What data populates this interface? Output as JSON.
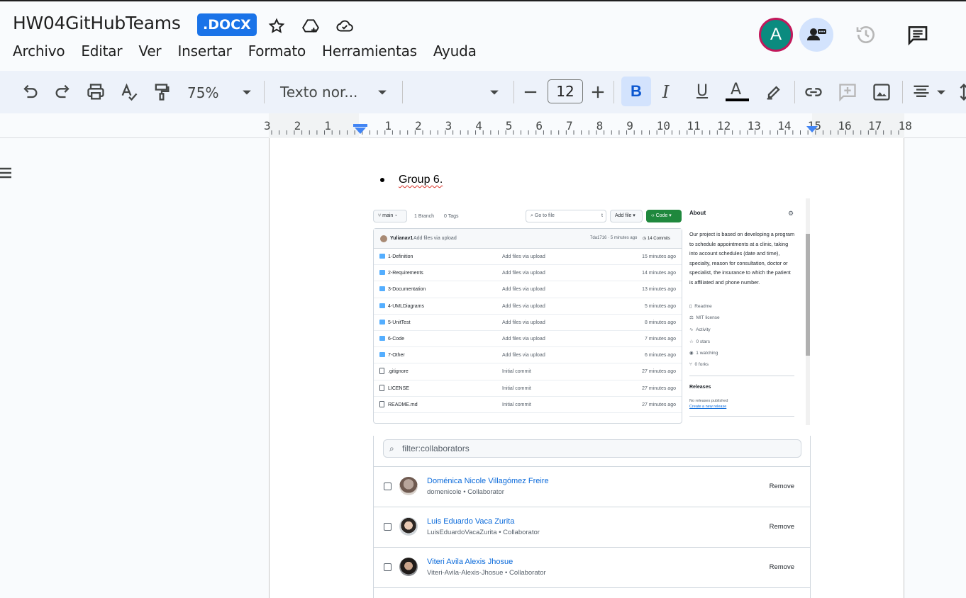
{
  "header": {
    "doc_title": "HW04GitHubTeams",
    "badge": ".DOCX",
    "avatar_letter": "A"
  },
  "menu": [
    "Archivo",
    "Editar",
    "Ver",
    "Insertar",
    "Formato",
    "Herramientas",
    "Ayuda"
  ],
  "toolbar": {
    "zoom": "75%",
    "style": "Texto nor...",
    "font_size": "12",
    "bold": "B",
    "italic": "I",
    "underline": "U",
    "text_color": "A"
  },
  "ruler": [
    "3",
    "2",
    "1",
    "1",
    "2",
    "3",
    "4",
    "5",
    "6",
    "7",
    "8",
    "9",
    "10",
    "11",
    "12",
    "13",
    "14",
    "15",
    "16",
    "17",
    "18"
  ],
  "document": {
    "bullet": "Group 6."
  },
  "repo": {
    "branch": "main",
    "branch_count": "1 Branch",
    "tags": "0 Tags",
    "search_placeholder": "Go to file",
    "search_key": "t",
    "add_file": "Add file",
    "code": "Code",
    "last_author": "Yulianav1",
    "last_message": "Add files via upload",
    "last_hash": "7da1716 · 5 minutes ago",
    "commits": "14 Commits",
    "files": [
      {
        "name": "1-Definition",
        "msg": "Add files via upload",
        "time": "15 minutes ago",
        "kind": "folder"
      },
      {
        "name": "2-Requirements",
        "msg": "Add files via upload",
        "time": "14 minutes ago",
        "kind": "folder"
      },
      {
        "name": "3-Documentation",
        "msg": "Add files via upload",
        "time": "13 minutes ago",
        "kind": "folder"
      },
      {
        "name": "4-UMLDiagrams",
        "msg": "Add files via upload",
        "time": "5 minutes ago",
        "kind": "folder"
      },
      {
        "name": "5-UnitTest",
        "msg": "Add files via upload",
        "time": "8 minutes ago",
        "kind": "folder"
      },
      {
        "name": "6-Code",
        "msg": "Add files via upload",
        "time": "7 minutes ago",
        "kind": "folder"
      },
      {
        "name": "7-Other",
        "msg": "Add files via upload",
        "time": "6 minutes ago",
        "kind": "folder"
      },
      {
        "name": ".gitignore",
        "msg": "Initial commit",
        "time": "27 minutes ago",
        "kind": "file"
      },
      {
        "name": "LICENSE",
        "msg": "Initial commit",
        "time": "27 minutes ago",
        "kind": "file"
      },
      {
        "name": "README.md",
        "msg": "Initial commit",
        "time": "27 minutes ago",
        "kind": "file"
      }
    ],
    "about_title": "About",
    "about_desc": "Our project is based on developing a program to schedule appointments at a clinic, taking into account schedules (date and time), specialty, reason for consultation, doctor or specialist, the insurance to which the patient is affiliated and phone number.",
    "about_items": [
      "Readme",
      "MIT license",
      "Activity",
      "0 stars",
      "1 watching",
      "0 forks"
    ],
    "releases_title": "Releases",
    "releases_none": "No releases published",
    "releases_link": "Create a new release"
  },
  "collaborators": {
    "filter": "filter:collaborators",
    "remove": "Remove",
    "list": [
      {
        "name": "Doménica Nicole Villagómez Freire",
        "sub": "domenicole • Collaborator"
      },
      {
        "name": "Luis Eduardo Vaca Zurita",
        "sub": "LuisEduardoVacaZurita • Collaborator"
      },
      {
        "name": "Viteri Avila Alexis Jhosue",
        "sub": "Viteri-Avila-Alexis-Jhosue • Collaborator"
      }
    ]
  }
}
